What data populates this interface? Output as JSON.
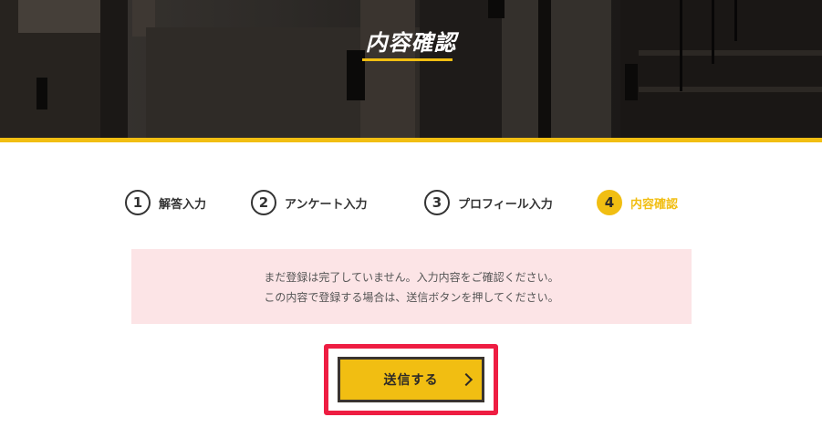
{
  "header": {
    "title": "内容確認"
  },
  "steps": [
    {
      "number": "1",
      "label": "解答入力",
      "active": false
    },
    {
      "number": "2",
      "label": "アンケート入力",
      "active": false
    },
    {
      "number": "3",
      "label": "プロフィール入力",
      "active": false
    },
    {
      "number": "4",
      "label": "内容確認",
      "active": true
    }
  ],
  "notice": {
    "line1": "まだ登録は完了していません。入力内容をご確認ください。",
    "line2": "この内容で登録する場合は、送信ボタンを押してください。"
  },
  "submit": {
    "label": "送信する",
    "icon": "chevron-right-icon"
  },
  "colors": {
    "accent": "#f1be12",
    "highlight": "#ee1d42",
    "notice_bg": "#fce4e6",
    "header_bg": "#1e1b19"
  }
}
